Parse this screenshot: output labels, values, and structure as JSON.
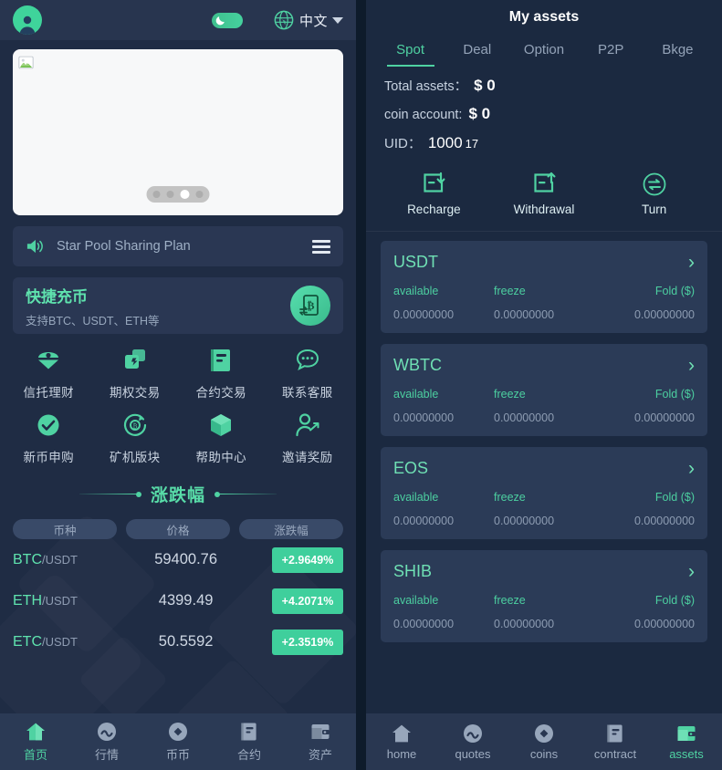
{
  "left": {
    "header": {
      "avatar": "user-avatar",
      "theme_toggle": "dark-mode-toggle",
      "globe_icon": "globe-icon",
      "language": "中文",
      "caret": "chevron-down-icon"
    },
    "banner": {
      "image_alt": "broken-image",
      "dots_total": 4,
      "dots_active_index": 2
    },
    "notice": {
      "icon": "speaker-icon",
      "text": "Star Pool Sharing Plan",
      "menu_icon": "hamburger-menu-icon"
    },
    "recharge": {
      "title": "快捷充币",
      "subtitle": "支持BTC、USDT、ETH等",
      "icon": "bitcoin-document-icon"
    },
    "grid": [
      {
        "label": "信托理财",
        "icon": "trust-finance-icon"
      },
      {
        "label": "期权交易",
        "icon": "option-trade-icon"
      },
      {
        "label": "合约交易",
        "icon": "contract-trade-icon"
      },
      {
        "label": "联系客服",
        "icon": "customer-service-icon"
      },
      {
        "label": "新币申购",
        "icon": "new-coin-icon"
      },
      {
        "label": "矿机版块",
        "icon": "mining-icon"
      },
      {
        "label": "帮助中心",
        "icon": "help-center-icon"
      },
      {
        "label": "邀请奖励",
        "icon": "invite-reward-icon"
      }
    ],
    "market": {
      "title": "涨跌幅",
      "columns": [
        "币种",
        "价格",
        "涨跌幅"
      ],
      "rows": [
        {
          "base": "BTC",
          "quote": "/USDT",
          "price": "59400.76",
          "change": "+2.9649%"
        },
        {
          "base": "ETH",
          "quote": "/USDT",
          "price": "4399.49",
          "change": "+4.2071%"
        },
        {
          "base": "ETC",
          "quote": "/USDT",
          "price": "50.5592",
          "change": "+2.3519%"
        }
      ]
    },
    "bottom_nav": [
      {
        "label": "首页",
        "icon": "home-icon",
        "active": true
      },
      {
        "label": "行情",
        "icon": "quotes-icon",
        "active": false
      },
      {
        "label": "币币",
        "icon": "coins-icon",
        "active": false
      },
      {
        "label": "合约",
        "icon": "contract-icon",
        "active": false
      },
      {
        "label": "资产",
        "icon": "assets-wallet-icon",
        "active": false
      }
    ]
  },
  "right": {
    "title": "My assets",
    "tabs": [
      {
        "label": "Spot",
        "active": true
      },
      {
        "label": "Deal",
        "active": false
      },
      {
        "label": "Option",
        "active": false
      },
      {
        "label": "P2P",
        "active": false
      },
      {
        "label": "Bkge",
        "active": false
      }
    ],
    "stats": {
      "total_label": "Total assets：",
      "total_value": "$ 0",
      "coin_label": "coin account:",
      "coin_value": "$ 0",
      "uid_label": "UID：",
      "uid_value": "1000",
      "uid_suffix": "17"
    },
    "actions": [
      {
        "label": "Recharge",
        "icon": "recharge-icon"
      },
      {
        "label": "Withdrawal",
        "icon": "withdrawal-icon"
      },
      {
        "label": "Turn",
        "icon": "transfer-icon"
      }
    ],
    "asset_columns": [
      "available",
      "freeze",
      "Fold ($)"
    ],
    "assets": [
      {
        "coin": "USDT",
        "available": "0.00000000",
        "freeze": "0.00000000",
        "fold": "0.00000000"
      },
      {
        "coin": "WBTC",
        "available": "0.00000000",
        "freeze": "0.00000000",
        "fold": "0.00000000"
      },
      {
        "coin": "EOS",
        "available": "0.00000000",
        "freeze": "0.00000000",
        "fold": "0.00000000"
      },
      {
        "coin": "SHIB",
        "available": "0.00000000",
        "freeze": "0.00000000",
        "fold": "0.00000000"
      }
    ],
    "bottom_nav": [
      {
        "label": "home",
        "icon": "home-icon",
        "active": false
      },
      {
        "label": "quotes",
        "icon": "quotes-icon",
        "active": false
      },
      {
        "label": "coins",
        "icon": "coins-icon",
        "active": false
      },
      {
        "label": "contract",
        "icon": "contract-icon",
        "active": false
      },
      {
        "label": "assets",
        "icon": "assets-wallet-icon",
        "active": true
      }
    ]
  },
  "colors": {
    "accent_green": "#4fd2a2",
    "badge_green": "#3fcf9c",
    "panel": "#2b3b57",
    "bg_left": "#1f2c44",
    "bg_right": "#1b2940"
  }
}
